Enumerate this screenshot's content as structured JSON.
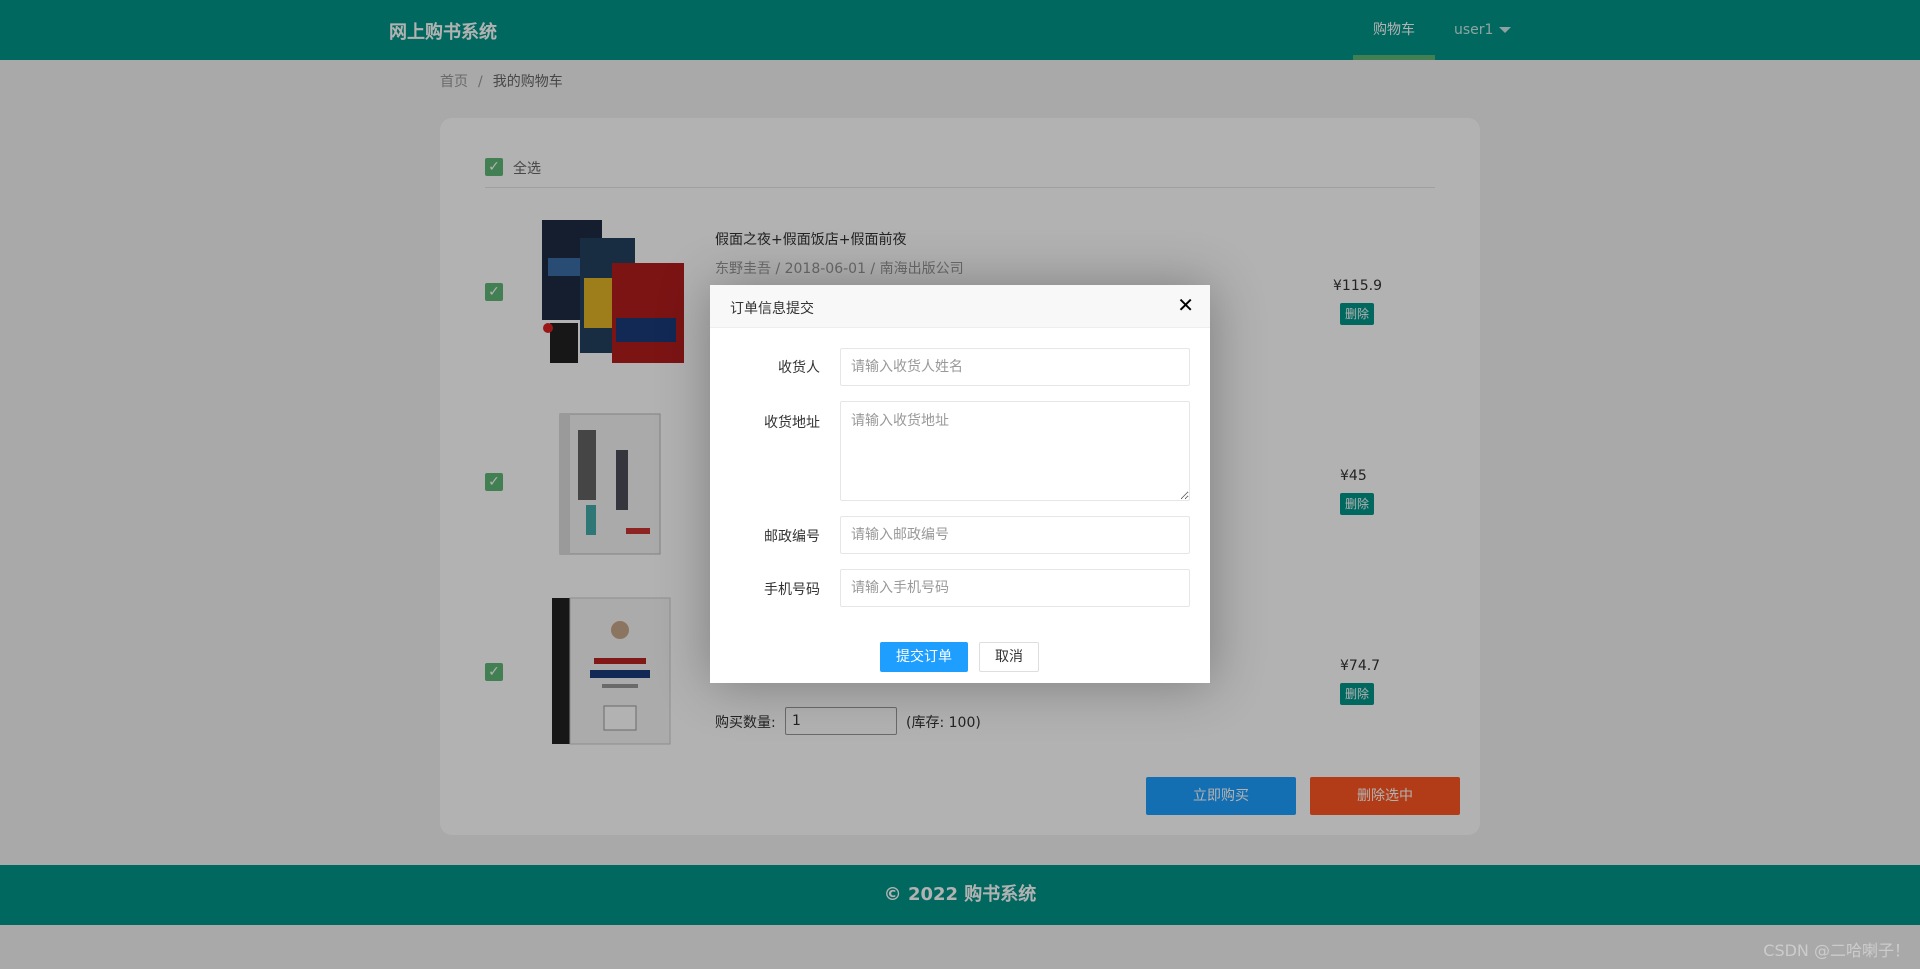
{
  "header": {
    "brand": "网上购书系统",
    "nav_cart": "购物车",
    "nav_user": "user1"
  },
  "breadcrumb": {
    "home": "首页",
    "separator": "/",
    "current": "我的购物车"
  },
  "cart": {
    "select_all_label": "全选",
    "items": [
      {
        "title": "假面之夜+假面饭店+假面前夜",
        "meta": "东野圭吾 / 2018-06-01 / 南海出版公司",
        "price": "¥115.9",
        "delete_label": "删除",
        "checked": true
      },
      {
        "title": "",
        "meta": "",
        "price": "¥45",
        "delete_label": "删除",
        "checked": true
      },
      {
        "title": "",
        "meta": "",
        "price": "¥74.7",
        "delete_label": "删除",
        "checked": true,
        "qty_label": "购买数量:",
        "qty_value": "1",
        "stock": "(库存: 100)"
      }
    ],
    "buy_now_label": "立即购买",
    "delete_selected_label": "删除选中"
  },
  "footer": {
    "text": "© 2022 购书系统"
  },
  "watermark": "CSDN @二哈喇子！",
  "modal": {
    "title": "订单信息提交",
    "fields": [
      {
        "label": "收货人",
        "placeholder": "请输入收货人姓名"
      },
      {
        "label": "收货地址",
        "placeholder": "请输入收货地址"
      },
      {
        "label": "邮政编号",
        "placeholder": "请输入邮政编号"
      },
      {
        "label": "手机号码",
        "placeholder": "请输入手机号码"
      }
    ],
    "submit_label": "提交订单",
    "cancel_label": "取消"
  },
  "colors": {
    "header_bg": "#009688",
    "nav_active_bar": "#5FB878",
    "primary_blue": "#1E9FFF",
    "danger_orange": "#FF5722"
  },
  "icons": {
    "checkbox": "check-icon",
    "close": "close-icon",
    "dropdown": "caret-down-icon"
  }
}
